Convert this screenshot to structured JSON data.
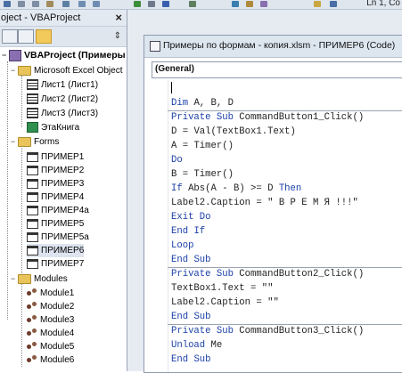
{
  "toolbar": {
    "status": "Ln 1, Co"
  },
  "explorer": {
    "title": "oject - VBAProject",
    "close": "×",
    "toolbar_scroll": "⇕",
    "project": "VBAProject (Примеры",
    "folders": {
      "excel_objects": "Microsoft Excel Object",
      "forms": "Forms",
      "modules": "Modules"
    },
    "sheets": [
      "Лист1 (Лист1)",
      "Лист2 (Лист2)",
      "Лист3 (Лист3)"
    ],
    "workbook": "ЭтаКнига",
    "forms": [
      "ПРИМЕР1",
      "ПРИМЕР2",
      "ПРИМЕР3",
      "ПРИМЕР4",
      "ПРИМЕР4а",
      "ПРИМЕР5",
      "ПРИМЕР5а",
      "ПРИМЕР6",
      "ПРИМЕР7"
    ],
    "modules": [
      "Module1",
      "Module2",
      "Module3",
      "Module4",
      "Module5",
      "Module6"
    ]
  },
  "code_window": {
    "title": "Примеры по формам - копия.xlsm - ПРИМЕР6 (Code)",
    "object_combo": "(General)",
    "lines": [
      "",
      "Dim A, B, D",
      "Private Sub CommandButton1_Click()",
      "D = Val(TextBox1.Text)",
      "A = Timer()",
      "Do",
      "B = Timer()",
      "If Abs(A - B) >= D Then",
      "Label2.Caption = \" В Р Е М Я !!!\"",
      "Exit Do",
      "End If",
      "Loop",
      "End Sub",
      "Private Sub CommandButton2_Click()",
      "TextBox1.Text = \"\"",
      "Label2.Caption = \"\"",
      "End Sub",
      "Private Sub CommandButton3_Click()",
      "Unload Me",
      "End Sub"
    ]
  },
  "colors": {
    "keyword": "#1a3fa8",
    "text": "#222222",
    "folder": "#e9c45a"
  }
}
